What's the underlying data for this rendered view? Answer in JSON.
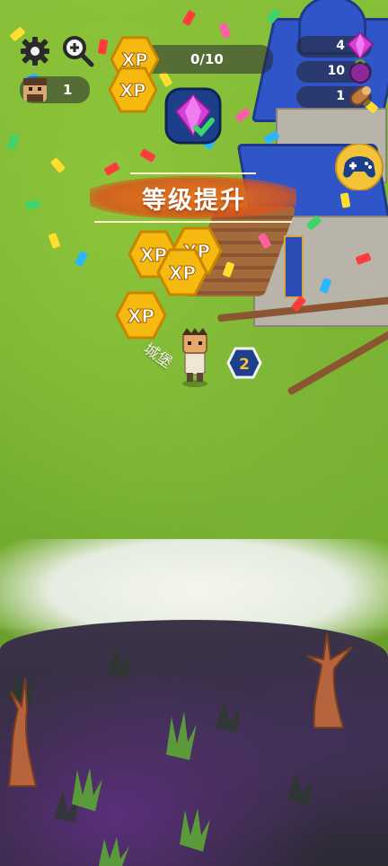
{
  "hud": {
    "settings_icon": "gear-icon",
    "zoom_icon": "zoom-in-icon",
    "level": "1",
    "xp_progress": "0/10",
    "xp_badge_label": "XP"
  },
  "resources": {
    "gems": "4",
    "berries": "10",
    "wood": "1"
  },
  "center_icon": "gem-reward-icon",
  "side_button_icon": "gamepad-icon",
  "level_up_text": "等级提升",
  "floating_xp": [
    "XP",
    "XP",
    "XP",
    "XP"
  ],
  "building": {
    "label": "城堡",
    "level_badge": "2"
  },
  "colors": {
    "grass": "#86bf38",
    "roof": "#2f55c8",
    "xp_gold": "#f6b90f",
    "gem": "#d63fd8",
    "hud_pill": "#2a2a32",
    "level_up_band": "#e8661c"
  }
}
